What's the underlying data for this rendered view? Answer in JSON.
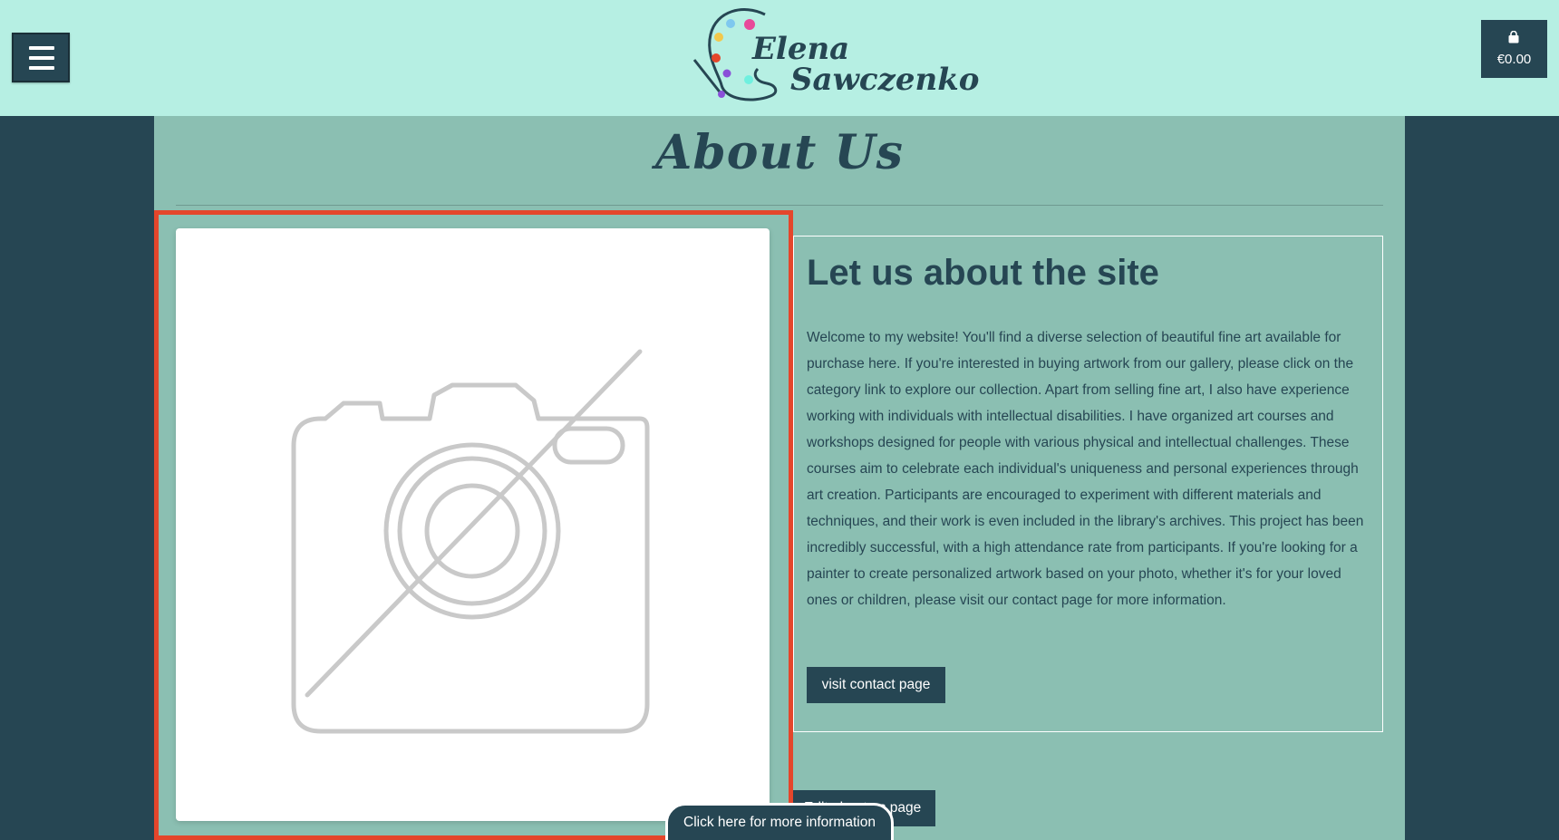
{
  "header": {
    "menu_icon": "hamburger-menu-icon",
    "logo": {
      "line1": "Elena",
      "line2": "Sawczenko",
      "icon": "palette-brush-icon"
    },
    "cart": {
      "icon": "shopping-bag-icon",
      "total": "€0.00"
    }
  },
  "main": {
    "title": "About Us",
    "image_placeholder_icon": "no-image-camera-icon",
    "info": {
      "heading": "Let us about the site",
      "body": "Welcome to my website! You'll find a diverse selection of beautiful fine art available for purchase here. If you're interested in buying artwork from our gallery, please click on the category link to explore our collection. Apart from selling fine art, I also have experience working with individuals with intellectual disabilities. I have organized art courses and workshops designed for people with various physical and intellectual challenges. These courses aim to celebrate each individual's uniqueness and personal experiences through art creation. Participants are encouraged to experiment with different materials and techniques, and their work is even included in the library's archives. This project has been incredibly successful, with a high attendance rate from participants. If you're looking for a painter to create personalized artwork based on your photo, whether it's for your loved ones or children, please visit our contact page for more information.",
      "contact_button": "visit contact page"
    },
    "edit_button": "Edit about us page",
    "more_info_tab": "Click here for more information"
  },
  "colors": {
    "header_bg": "#b6efe3",
    "page_bg": "#264653",
    "content_bg": "#8bbfb2",
    "accent_dark": "#264653",
    "highlight_border": "#e4462b"
  }
}
